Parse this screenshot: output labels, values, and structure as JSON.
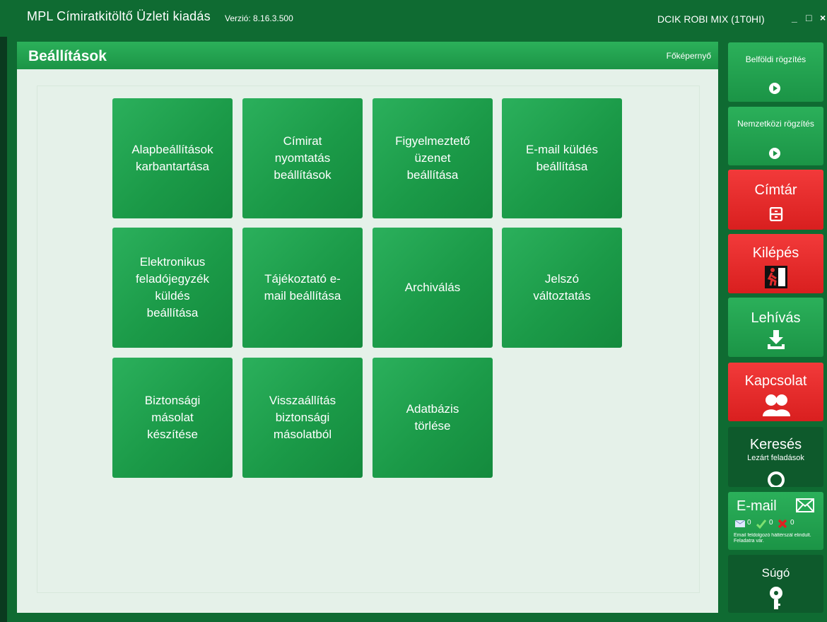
{
  "titlebar": {
    "app_title": "MPL Címiratkitöltő Üzleti kiadás",
    "version": "Verzió: 8.16.3.500",
    "user": "DCIK ROBI MIX (1T0HI)",
    "minimize": "_",
    "maximize": "□",
    "close": "×"
  },
  "panel": {
    "title": "Beállítások",
    "home_link": "Főképernyő"
  },
  "tiles": [
    "Alapbeállítások\nkarbantartása",
    "Címirat\nnyomtatás\nbeállítások",
    "Figyelmeztető\nüzenet\nbeállítása",
    "E-mail küldés\nbeállítása",
    "Elektronikus\nfeladójegyzék\nküldés\nbeállítása",
    "Tájékoztató e-\nmail beállítása",
    "Archiválás",
    "Jelszó\nváltoztatás",
    "Biztonsági\nmásolat\nkészítése",
    "Visszaállítás\nbiztonsági\nmásolatból",
    "Adatbázis\ntörlése"
  ],
  "sidebar": {
    "domestic": "Belföldi rögzítés",
    "international": "Nemzetközi rögzítés",
    "address_book": "Címtár",
    "exit": "Kilépés",
    "fetch": "Lehívás",
    "contact": "Kapcsolat",
    "search": "Keresés",
    "search_sub": "Lezárt feladások",
    "email": "E-mail",
    "email_count_sent": "0",
    "email_count_ok": "0",
    "email_count_err": "0",
    "email_status": "Email feldolgozó háttérszál elindult. Feladatra vár.",
    "help": "Súgó"
  },
  "colors": {
    "app_background": "#0f6b32",
    "tile_green": "#1f9e4c",
    "sidebar_red": "#e32c2c",
    "panel_background": "#e5f1e9"
  }
}
